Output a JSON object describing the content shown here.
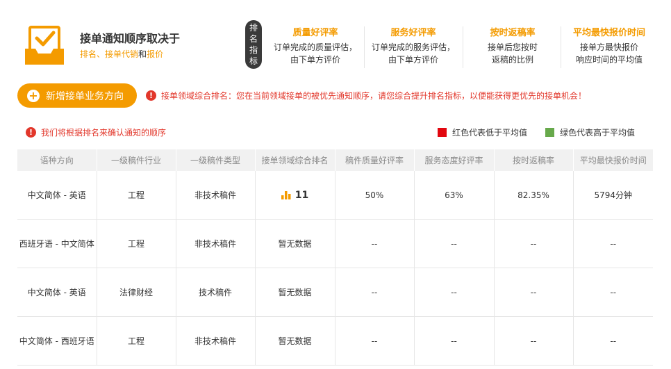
{
  "intro": {
    "title": "接单通知顺序取决于",
    "subtitle_parts": [
      "排名",
      "、",
      "接单代销",
      "和",
      "报价"
    ]
  },
  "metrics_badge": [
    "排",
    "名",
    "指",
    "标"
  ],
  "metrics": [
    {
      "title": "质量好评率",
      "desc1": "订单完成的质量评估，",
      "desc2": "由下单方评价"
    },
    {
      "title": "服务好评率",
      "desc1": "订单完成的服务评估，",
      "desc2": "由下单方评价"
    },
    {
      "title": "按时返稿率",
      "desc1": "接单后您按时",
      "desc2": "返稿的比例"
    },
    {
      "title": "平均最快报价时间",
      "desc1": "接单方最快报价",
      "desc2": "响应时间的平均值"
    }
  ],
  "add_button_label": "新增接单业务方向",
  "notice_main": "接单领域综合排名：您在当前领域接单的被优先通知顺序，请您综合提升排名指标，以便能获得更优先的接单机会！",
  "notice_order": "我们将根据排名来确认通知的顺序",
  "legend": {
    "red": {
      "label": "红色代表低于平均值",
      "color": "#e2070f"
    },
    "green": {
      "label": "绿色代表高于平均值",
      "color": "#67a94b"
    }
  },
  "table": {
    "headers": [
      "语种方向",
      "一级稿件行业",
      "一级稿件类型",
      "接单领域综合排名",
      "稿件质量好评率",
      "服务态度好评率",
      "按时返稿率",
      "平均最快报价时间"
    ],
    "rows": [
      {
        "lang": "中文简体 - 英语",
        "industry": "工程",
        "type": "非技术稿件",
        "rank": "11",
        "quality": "50%",
        "service": "63%",
        "ontime": "82.35%",
        "quote": "5794分钟"
      },
      {
        "lang": "西班牙语 - 中文简体",
        "industry": "工程",
        "type": "非技术稿件",
        "rank": "暂无数据",
        "quality": "--",
        "service": "--",
        "ontime": "--",
        "quote": "--"
      },
      {
        "lang": "中文简体 - 英语",
        "industry": "法律财经",
        "type": "技术稿件",
        "rank": "暂无数据",
        "quality": "--",
        "service": "--",
        "ontime": "--",
        "quote": "--"
      },
      {
        "lang": "中文简体 - 西班牙语",
        "industry": "工程",
        "type": "非技术稿件",
        "rank": "暂无数据",
        "quality": "--",
        "service": "--",
        "ontime": "--",
        "quote": "--"
      }
    ]
  },
  "colors": {
    "accent": "#f49b00",
    "warning": "#e2372b",
    "below_avg": "#e2372b",
    "above_avg": "#5aa33c"
  }
}
